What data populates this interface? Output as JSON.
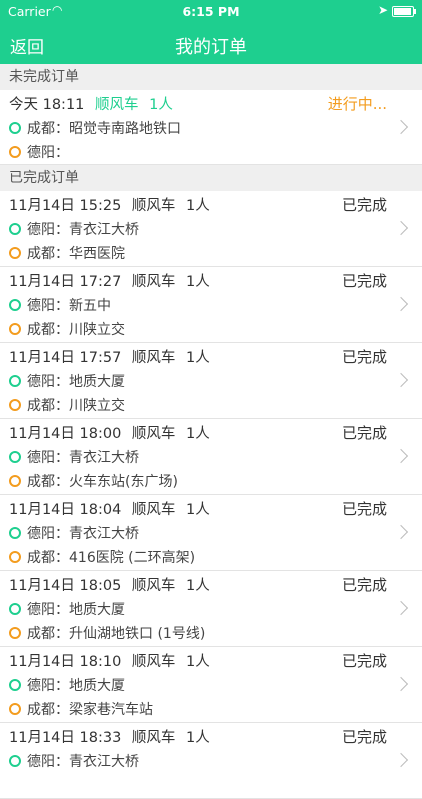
{
  "status_bar": {
    "carrier": "Carrier",
    "time": "6:15 PM"
  },
  "nav": {
    "back_label": "返回",
    "title": "我的订单"
  },
  "pending": {
    "header": "未完成订单",
    "order": {
      "time": "今天 18:11",
      "type": "顺风车",
      "count": "1人",
      "status": "进行中...",
      "from_city": "成都：",
      "from_place": "昭觉寺南路地铁口",
      "to_city": "德阳：",
      "to_place": ""
    }
  },
  "completed": {
    "header": "已完成订单",
    "orders": [
      {
        "time": "11月14日 15:25",
        "type": "顺风车",
        "count": "1人",
        "status": "已完成",
        "from_city": "德阳：",
        "from_place": "青衣江大桥",
        "to_city": "成都：",
        "to_place": "华西医院"
      },
      {
        "time": "11月14日 17:27",
        "type": "顺风车",
        "count": "1人",
        "status": "已完成",
        "from_city": "德阳：",
        "from_place": "新五中",
        "to_city": "成都：",
        "to_place": "川陕立交"
      },
      {
        "time": "11月14日 17:57",
        "type": "顺风车",
        "count": "1人",
        "status": "已完成",
        "from_city": "德阳：",
        "from_place": "地质大厦",
        "to_city": "成都：",
        "to_place": "川陕立交"
      },
      {
        "time": "11月14日 18:00",
        "type": "顺风车",
        "count": "1人",
        "status": "已完成",
        "from_city": "德阳：",
        "from_place": "青衣江大桥",
        "to_city": "成都：",
        "to_place": "火车东站(东广场)"
      },
      {
        "time": "11月14日 18:04",
        "type": "顺风车",
        "count": "1人",
        "status": "已完成",
        "from_city": "德阳：",
        "from_place": "青衣江大桥",
        "to_city": "成都：",
        "to_place": "416医院 (二环高架)"
      },
      {
        "time": "11月14日 18:05",
        "type": "顺风车",
        "count": "1人",
        "status": "已完成",
        "from_city": "德阳：",
        "from_place": "地质大厦",
        "to_city": "成都：",
        "to_place": "升仙湖地铁口 (1号线)"
      },
      {
        "time": "11月14日 18:10",
        "type": "顺风车",
        "count": "1人",
        "status": "已完成",
        "from_city": "德阳：",
        "from_place": "地质大厦",
        "to_city": "成都：",
        "to_place": "梁家巷汽车站"
      },
      {
        "time": "11月14日 18:33",
        "type": "顺风车",
        "count": "1人",
        "status": "已完成",
        "from_city": "德阳：",
        "from_place": "青衣江大桥",
        "to_city": "",
        "to_place": ""
      }
    ]
  }
}
